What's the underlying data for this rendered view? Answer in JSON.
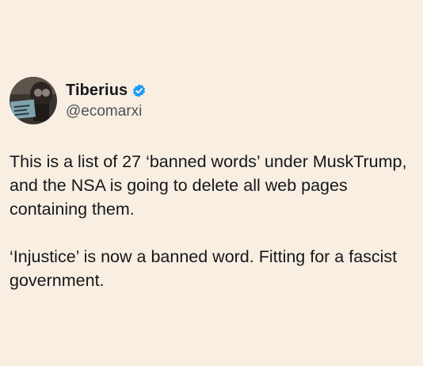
{
  "author": {
    "display_name": "Tiberius",
    "handle": "@ecomarxi",
    "verified": true,
    "badge_color": "#1d9bf0"
  },
  "tweet": {
    "paragraphs": [
      "This is a list of 27 ‘banned words’ under MuskTrump, and the NSA is going to delete all web pages containing them.",
      "‘Injustice’ is now a banned word. Fitting for a fascist government."
    ]
  },
  "colors": {
    "background": "#f8efe2",
    "text": "#15171a",
    "secondary_text": "#4d5257"
  }
}
